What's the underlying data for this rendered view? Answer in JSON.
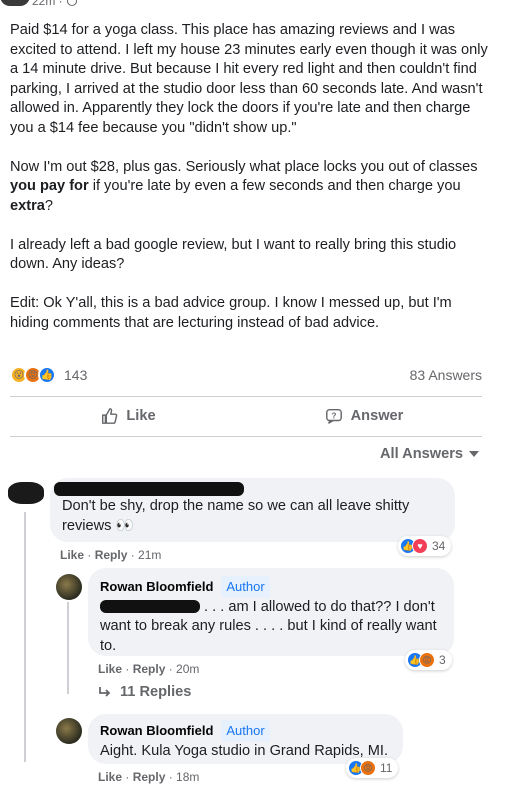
{
  "post": {
    "timestamp": "22m ·",
    "paragraphs": {
      "p1": "Paid $14 for a yoga class. This place has amazing reviews and I was excited to attend. I left my house 23 minutes early even though it was only a 14 minute drive. But because I hit every red light and then couldn't find parking, I arrived at the studio door less than 60 seconds late. And wasn't allowed in. Apparently they lock the doors if you're late and then charge you a $14 fee because you \"didn't show up.\"",
      "p2_a": "Now I'm out $28, plus gas. Seriously what place locks you out of classes ",
      "p2_b": "you pay for",
      "p2_c": " if you're late by even a few seconds and then charge you ",
      "p2_d": "extra",
      "p2_e": "?",
      "p3": "I already left a bad google review, but I want to really bring this studio down. Any ideas?",
      "p4": "Edit: Ok Y'all, this is a bad advice group. I know I messed up, but I'm hiding comments that are lecturing instead of bad advice."
    },
    "reaction_count": "143",
    "answers_count": "83 Answers"
  },
  "actions": {
    "like": "Like",
    "answer": "Answer"
  },
  "filter": {
    "label": "All Answers"
  },
  "comments": [
    {
      "text": "Don't be shy, drop the name so we can all leave shitty reviews 👀",
      "like": "Like",
      "reply": "Reply",
      "time": "21m",
      "reactions": "34"
    },
    {
      "name": "Rowan Bloomfield",
      "badge": "Author",
      "text": ". . . am I allowed to do that?? I don't want to break any rules . . . . but I kind of really want to.",
      "like": "Like",
      "reply": "Reply",
      "time": "20m",
      "reactions": "3"
    },
    {
      "name": "Rowan Bloomfield",
      "badge": "Author",
      "text": "Aight. Kula Yoga studio in Grand Rapids, MI.",
      "like": "Like",
      "reply": "Reply",
      "time": "18m",
      "reactions": "11"
    }
  ],
  "replies_link": "11 Replies",
  "separator": " · ",
  "colors": {
    "brand_blue": "#1877f2",
    "secondary_text": "#65676b",
    "bubble_bg": "#f0f2f5"
  }
}
